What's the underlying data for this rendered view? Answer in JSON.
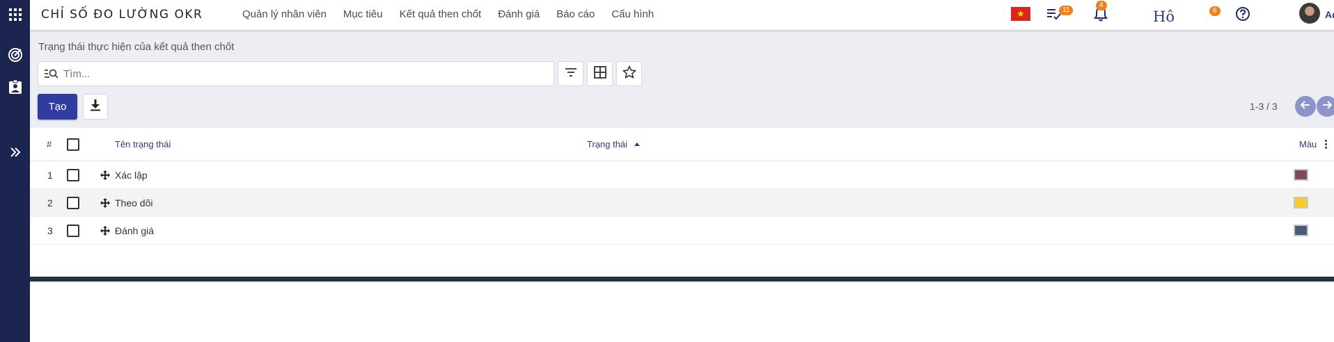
{
  "app": {
    "title": "CHỈ SỐ ĐO LƯỜNG OKR"
  },
  "menu": [
    {
      "label": "Quản lý nhân viên"
    },
    {
      "label": "Mục tiêu"
    },
    {
      "label": "Kết quả then chốt"
    },
    {
      "label": "Đánh giá"
    },
    {
      "label": "Báo cáo"
    },
    {
      "label": "Cấu hình"
    }
  ],
  "systray": {
    "activity_count": "11",
    "notification_count": "4",
    "ho_text": "Hô",
    "extra_count": "6",
    "user_name": "Admin"
  },
  "breadcrumb": "Trạng thái thực hiện của kết quả then chốt",
  "search": {
    "placeholder": "Tìm...",
    "value": ""
  },
  "buttons": {
    "create_label": "Tạo"
  },
  "pager": {
    "text": "1-3 / 3"
  },
  "table": {
    "columns": {
      "index": "#",
      "name": "Tên trạng thái",
      "status": "Trạng thái",
      "color": "Màu"
    },
    "rows": [
      {
        "index": "1",
        "name": "Xác lập",
        "color": "#7e4a61"
      },
      {
        "index": "2",
        "name": "Theo dõi",
        "color": "#f6cd28"
      },
      {
        "index": "3",
        "name": "Đánh giá",
        "color": "#495a79"
      }
    ]
  },
  "colors": {
    "rail": "#1c2450",
    "primary": "#2f3e9e",
    "badge": "#f0801e"
  },
  "icons": [
    "apps-icon",
    "target-icon",
    "badge-icon",
    "expand-icon",
    "search-icon",
    "filter-icon",
    "grid-icon",
    "star-icon",
    "download-icon",
    "arrow-left-icon",
    "arrow-right-icon",
    "activity-icon",
    "bell-icon",
    "help-icon",
    "drag-icon"
  ]
}
